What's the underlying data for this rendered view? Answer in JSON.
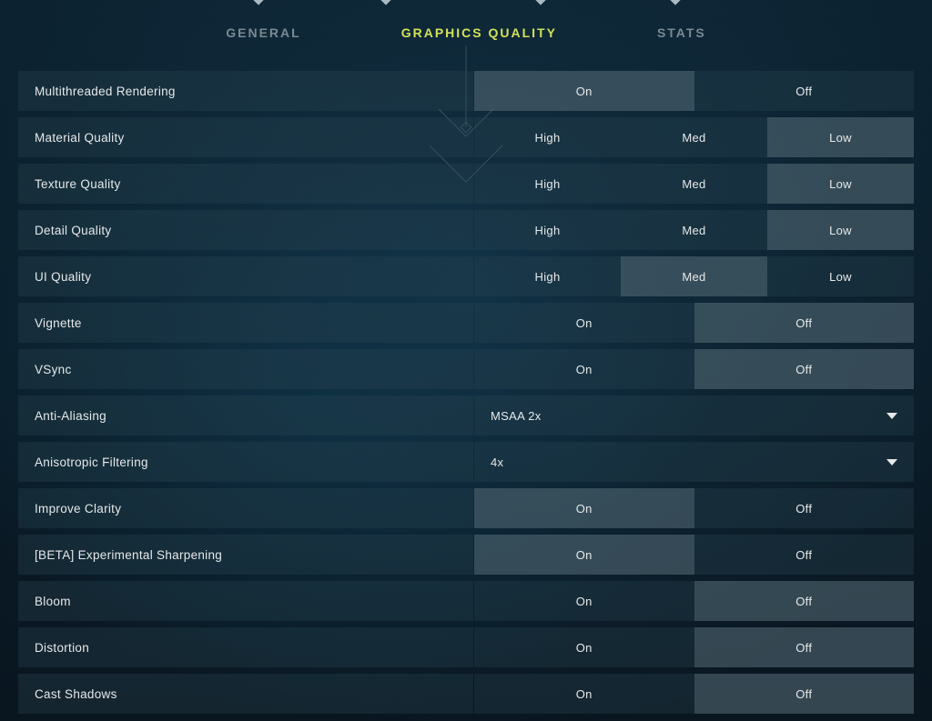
{
  "tabs": {
    "general": "GENERAL",
    "graphics": "GRAPHICS QUALITY",
    "stats": "STATS",
    "active": "graphics"
  },
  "options": {
    "onOff": {
      "on": "On",
      "off": "Off"
    },
    "quality": {
      "high": "High",
      "med": "Med",
      "low": "Low"
    }
  },
  "settings": [
    {
      "key": "multithreaded",
      "label": "Multithreaded Rendering",
      "type": "onoff",
      "value": "on"
    },
    {
      "key": "material",
      "label": "Material Quality",
      "type": "quality",
      "value": "low"
    },
    {
      "key": "texture",
      "label": "Texture Quality",
      "type": "quality",
      "value": "low"
    },
    {
      "key": "detail",
      "label": "Detail Quality",
      "type": "quality",
      "value": "low"
    },
    {
      "key": "ui",
      "label": "UI Quality",
      "type": "quality",
      "value": "med"
    },
    {
      "key": "vignette",
      "label": "Vignette",
      "type": "onoff",
      "value": "off"
    },
    {
      "key": "vsync",
      "label": "VSync",
      "type": "onoff",
      "value": "off"
    },
    {
      "key": "aa",
      "label": "Anti-Aliasing",
      "type": "dropdown",
      "value": "MSAA 2x"
    },
    {
      "key": "af",
      "label": "Anisotropic Filtering",
      "type": "dropdown",
      "value": "4x"
    },
    {
      "key": "clarity",
      "label": "Improve Clarity",
      "type": "onoff",
      "value": "on"
    },
    {
      "key": "sharpen",
      "label": "[BETA] Experimental Sharpening",
      "type": "onoff",
      "value": "on"
    },
    {
      "key": "bloom",
      "label": "Bloom",
      "type": "onoff",
      "value": "off"
    },
    {
      "key": "distortion",
      "label": "Distortion",
      "type": "onoff",
      "value": "off"
    },
    {
      "key": "shadows",
      "label": "Cast Shadows",
      "type": "onoff",
      "value": "off"
    }
  ]
}
